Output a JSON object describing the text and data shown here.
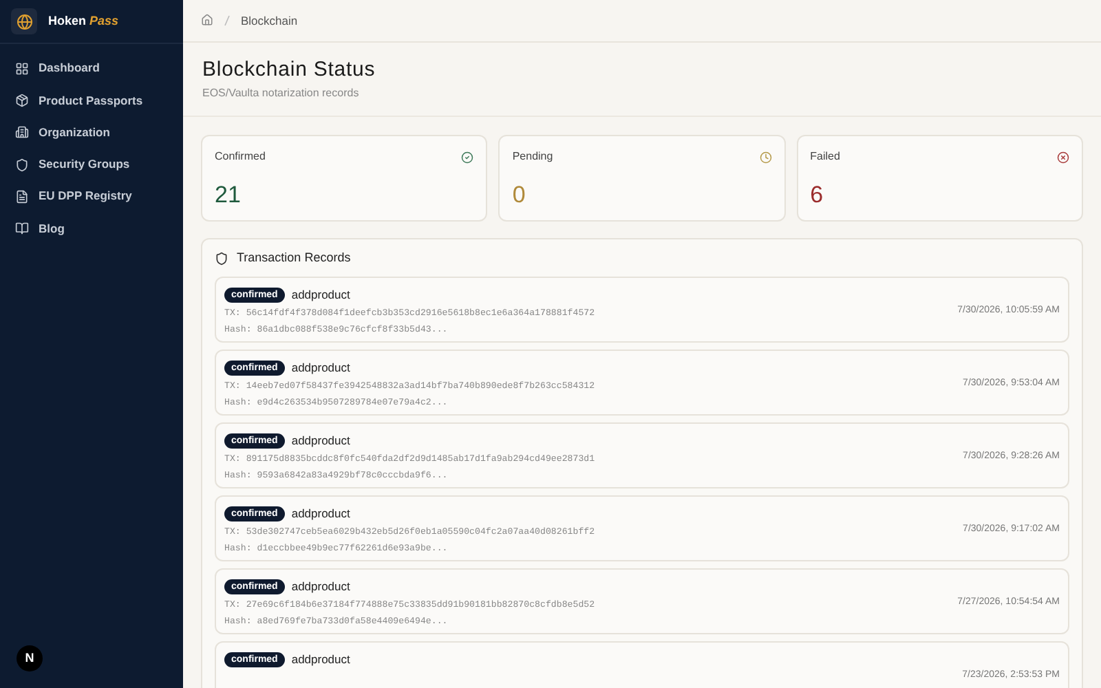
{
  "sidebar": {
    "brand": "Hoken",
    "brand_accent": "Pass",
    "items": [
      {
        "label": "Dashboard",
        "kind": "grid"
      },
      {
        "label": "Product Passports",
        "kind": "box"
      },
      {
        "label": "Organization",
        "kind": "building"
      },
      {
        "label": "Security Groups",
        "kind": "shield"
      },
      {
        "label": "EU DPP Registry",
        "kind": "file"
      },
      {
        "label": "Blog",
        "kind": "book"
      }
    ],
    "footer_badge": "N"
  },
  "breadcrumb": [
    "Blockchain"
  ],
  "header": {
    "title": "Blockchain Status",
    "subtitle": "EOS/Vaulta notarization records"
  },
  "stats": [
    {
      "label": "Confirmed",
      "value": "21",
      "kind": "confirmed"
    },
    {
      "label": "Pending",
      "value": "0",
      "kind": "pending"
    },
    {
      "label": "Failed",
      "value": "6",
      "kind": "failed"
    }
  ],
  "records": {
    "title": "Transaction Records",
    "rows": [
      {
        "status": "confirmed",
        "action": "addproduct",
        "tx": "TX: 56c14fdf4f378d084f1deefcb3b353cd2916e5618b8ec1e6a364a178881f4572",
        "hash": "Hash: 86a1dbc088f538e9c76cfcf8f33b5d43...",
        "time": "7/30/2026, 10:05:59 AM"
      },
      {
        "status": "confirmed",
        "action": "addproduct",
        "tx": "TX: 14eeb7ed07f58437fe3942548832a3ad14bf7ba740b890ede8f7b263cc584312",
        "hash": "Hash: e9d4c263534b9507289784e07e79a4c2...",
        "time": "7/30/2026, 9:53:04 AM"
      },
      {
        "status": "confirmed",
        "action": "addproduct",
        "tx": "TX: 891175d8835bcddc8f0fc540fda2df2d9d1485ab17d1fa9ab294cd49ee2873d1",
        "hash": "Hash: 9593a6842a83a4929bf78c0cccbda9f6...",
        "time": "7/30/2026, 9:28:26 AM"
      },
      {
        "status": "confirmed",
        "action": "addproduct",
        "tx": "TX: 53de302747ceb5ea6029b432eb5d26f0eb1a05590c04fc2a07aa40d08261bff2",
        "hash": "Hash: d1eccbbee49b9ec77f62261d6e93a9be...",
        "time": "7/30/2026, 9:17:02 AM"
      },
      {
        "status": "confirmed",
        "action": "addproduct",
        "tx": "TX: 27e69c6f184b6e37184f774888e75c33835dd91b90181bb82870c8cfdb8e5d52",
        "hash": "Hash: a8ed769fe7ba733d0fa58e4409e6494e...",
        "time": "7/27/2026, 10:54:54 AM"
      },
      {
        "status": "confirmed",
        "action": "addproduct",
        "time": "7/23/2026, 2:53:53 PM"
      }
    ]
  }
}
